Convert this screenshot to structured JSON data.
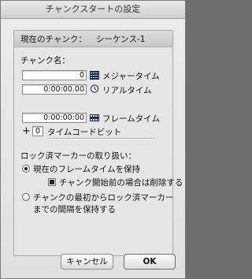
{
  "window": {
    "title": "チャンクスタートの設定"
  },
  "header": {
    "prefix": "現在のチャンク：",
    "chunk_name": "シーケンス-1"
  },
  "chunk_name_label": "チャンク名：",
  "meter": {
    "value": "0",
    "label": "メジャータイム",
    "icon": "meter-grid-icon"
  },
  "real": {
    "value": "0:00:00.00",
    "label": "リアルタイム",
    "icon": "clock-icon"
  },
  "frame": {
    "value": "0:00:00:00",
    "label": "フレームタイム",
    "icon": "film-frames-icon"
  },
  "timecode": {
    "value": "0",
    "label": "タイムコードビット"
  },
  "locked_markers": {
    "label": "ロック済マーカーの取り扱い：",
    "option1": "現在のフレームタイムを保持",
    "checkbox": "チャンク開始前の場合は削除する",
    "option2_line1": "チャンクの最初からロック済マーカー",
    "option2_line2": "までの間隔を保持する",
    "selected": "option1",
    "checkbox_checked": true
  },
  "buttons": {
    "cancel": "キャンセル",
    "ok": "OK"
  }
}
